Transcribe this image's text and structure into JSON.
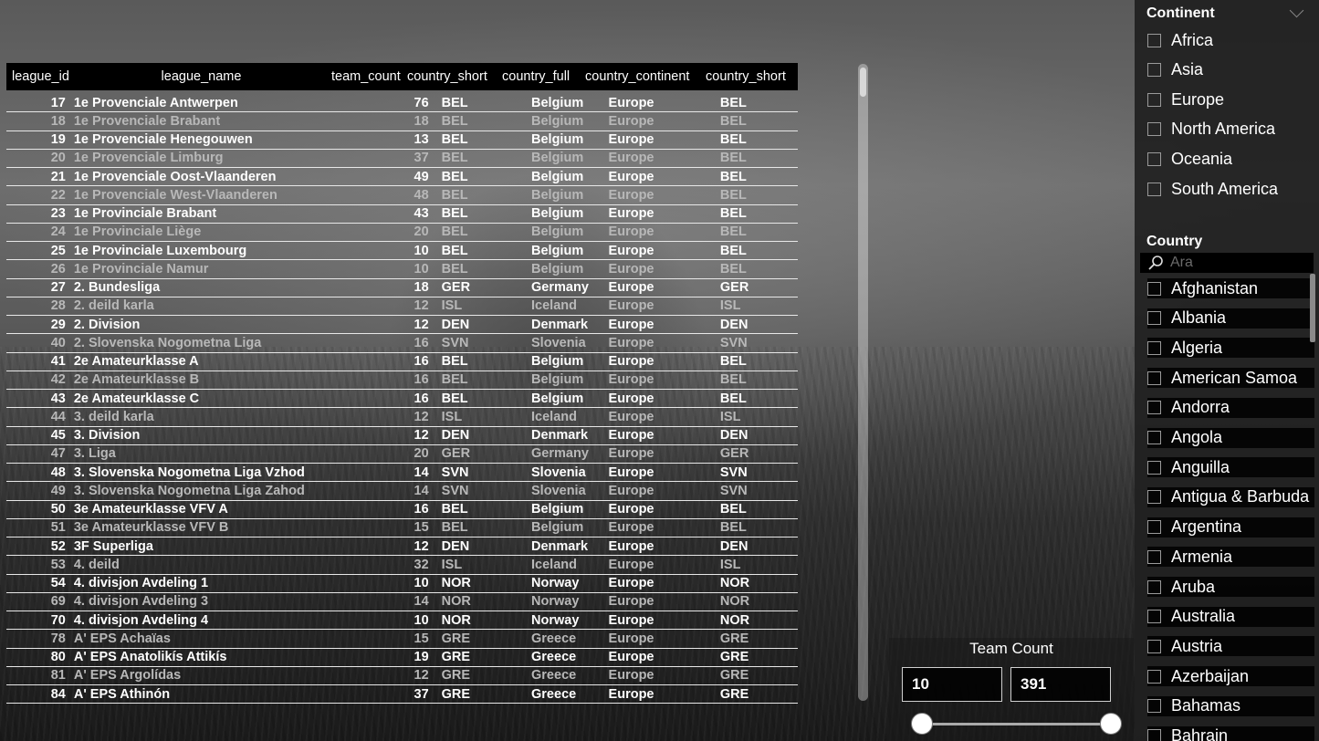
{
  "table": {
    "columns": [
      "league_id",
      "league_name",
      "team_count",
      "country_short",
      "country_full",
      "country_continent",
      "country_short"
    ],
    "rows": [
      {
        "id": "17",
        "name": "1e Provenciale Antwerpen",
        "count": "76",
        "short": "BEL",
        "full": "Belgium",
        "continent": "Europe",
        "short2": "BEL",
        "dim": false
      },
      {
        "id": "18",
        "name": "1e Provenciale Brabant",
        "count": "18",
        "short": "BEL",
        "full": "Belgium",
        "continent": "Europe",
        "short2": "BEL",
        "dim": true
      },
      {
        "id": "19",
        "name": "1e Provenciale Henegouwen",
        "count": "13",
        "short": "BEL",
        "full": "Belgium",
        "continent": "Europe",
        "short2": "BEL",
        "dim": false
      },
      {
        "id": "20",
        "name": "1e Provenciale Limburg",
        "count": "37",
        "short": "BEL",
        "full": "Belgium",
        "continent": "Europe",
        "short2": "BEL",
        "dim": true
      },
      {
        "id": "21",
        "name": "1e Provenciale Oost-Vlaanderen",
        "count": "49",
        "short": "BEL",
        "full": "Belgium",
        "continent": "Europe",
        "short2": "BEL",
        "dim": false
      },
      {
        "id": "22",
        "name": "1e Provenciale West-Vlaanderen",
        "count": "48",
        "short": "BEL",
        "full": "Belgium",
        "continent": "Europe",
        "short2": "BEL",
        "dim": true
      },
      {
        "id": "23",
        "name": "1e Provinciale Brabant",
        "count": "43",
        "short": "BEL",
        "full": "Belgium",
        "continent": "Europe",
        "short2": "BEL",
        "dim": false
      },
      {
        "id": "24",
        "name": "1e Provinciale Liège",
        "count": "20",
        "short": "BEL",
        "full": "Belgium",
        "continent": "Europe",
        "short2": "BEL",
        "dim": true
      },
      {
        "id": "25",
        "name": "1e Provinciale Luxembourg",
        "count": "10",
        "short": "BEL",
        "full": "Belgium",
        "continent": "Europe",
        "short2": "BEL",
        "dim": false
      },
      {
        "id": "26",
        "name": "1e Provinciale Namur",
        "count": "10",
        "short": "BEL",
        "full": "Belgium",
        "continent": "Europe",
        "short2": "BEL",
        "dim": true
      },
      {
        "id": "27",
        "name": "2. Bundesliga",
        "count": "18",
        "short": "GER",
        "full": "Germany",
        "continent": "Europe",
        "short2": "GER",
        "dim": false
      },
      {
        "id": "28",
        "name": "2. deild karla",
        "count": "12",
        "short": "ISL",
        "full": "Iceland",
        "continent": "Europe",
        "short2": "ISL",
        "dim": true
      },
      {
        "id": "29",
        "name": "2. Division",
        "count": "12",
        "short": "DEN",
        "full": "Denmark",
        "continent": "Europe",
        "short2": "DEN",
        "dim": false
      },
      {
        "id": "40",
        "name": "2. Slovenska Nogometna Liga",
        "count": "16",
        "short": "SVN",
        "full": "Slovenia",
        "continent": "Europe",
        "short2": "SVN",
        "dim": true
      },
      {
        "id": "41",
        "name": "2e Amateurklasse A",
        "count": "16",
        "short": "BEL",
        "full": "Belgium",
        "continent": "Europe",
        "short2": "BEL",
        "dim": false
      },
      {
        "id": "42",
        "name": "2e Amateurklasse B",
        "count": "16",
        "short": "BEL",
        "full": "Belgium",
        "continent": "Europe",
        "short2": "BEL",
        "dim": true
      },
      {
        "id": "43",
        "name": "2e Amateurklasse C",
        "count": "16",
        "short": "BEL",
        "full": "Belgium",
        "continent": "Europe",
        "short2": "BEL",
        "dim": false
      },
      {
        "id": "44",
        "name": "3. deild karla",
        "count": "12",
        "short": "ISL",
        "full": "Iceland",
        "continent": "Europe",
        "short2": "ISL",
        "dim": true
      },
      {
        "id": "45",
        "name": "3. Division",
        "count": "12",
        "short": "DEN",
        "full": "Denmark",
        "continent": "Europe",
        "short2": "DEN",
        "dim": false
      },
      {
        "id": "47",
        "name": "3. Liga",
        "count": "20",
        "short": "GER",
        "full": "Germany",
        "continent": "Europe",
        "short2": "GER",
        "dim": true
      },
      {
        "id": "48",
        "name": "3. Slovenska Nogometna Liga Vzhod",
        "count": "14",
        "short": "SVN",
        "full": "Slovenia",
        "continent": "Europe",
        "short2": "SVN",
        "dim": false
      },
      {
        "id": "49",
        "name": "3. Slovenska Nogometna Liga Zahod",
        "count": "14",
        "short": "SVN",
        "full": "Slovenia",
        "continent": "Europe",
        "short2": "SVN",
        "dim": true
      },
      {
        "id": "50",
        "name": "3e Amateurklasse VFV A",
        "count": "16",
        "short": "BEL",
        "full": "Belgium",
        "continent": "Europe",
        "short2": "BEL",
        "dim": false
      },
      {
        "id": "51",
        "name": "3e Amateurklasse VFV B",
        "count": "15",
        "short": "BEL",
        "full": "Belgium",
        "continent": "Europe",
        "short2": "BEL",
        "dim": true
      },
      {
        "id": "52",
        "name": "3F Superliga",
        "count": "12",
        "short": "DEN",
        "full": "Denmark",
        "continent": "Europe",
        "short2": "DEN",
        "dim": false
      },
      {
        "id": "53",
        "name": "4. deild",
        "count": "32",
        "short": "ISL",
        "full": "Iceland",
        "continent": "Europe",
        "short2": "ISL",
        "dim": true
      },
      {
        "id": "54",
        "name": "4. divisjon Avdeling 1",
        "count": "10",
        "short": "NOR",
        "full": "Norway",
        "continent": "Europe",
        "short2": "NOR",
        "dim": false
      },
      {
        "id": "69",
        "name": "4. divisjon Avdeling 3",
        "count": "14",
        "short": "NOR",
        "full": "Norway",
        "continent": "Europe",
        "short2": "NOR",
        "dim": true
      },
      {
        "id": "70",
        "name": "4. divisjon Avdeling 4",
        "count": "10",
        "short": "NOR",
        "full": "Norway",
        "continent": "Europe",
        "short2": "NOR",
        "dim": false
      },
      {
        "id": "78",
        "name": "A' EPS Achaïas",
        "count": "15",
        "short": "GRE",
        "full": "Greece",
        "continent": "Europe",
        "short2": "GRE",
        "dim": true
      },
      {
        "id": "80",
        "name": "A' EPS Anatolikís Attikís",
        "count": "19",
        "short": "GRE",
        "full": "Greece",
        "continent": "Europe",
        "short2": "GRE",
        "dim": false
      },
      {
        "id": "81",
        "name": "A' EPS Argolídas",
        "count": "12",
        "short": "GRE",
        "full": "Greece",
        "continent": "Europe",
        "short2": "GRE",
        "dim": true
      },
      {
        "id": "84",
        "name": "A' EPS Athinón",
        "count": "37",
        "short": "GRE",
        "full": "Greece",
        "continent": "Europe",
        "short2": "GRE",
        "dim": false
      }
    ]
  },
  "continent_slicer": {
    "title": "Continent",
    "options": [
      "Africa",
      "Asia",
      "Europe",
      "North America",
      "Oceania",
      "South America"
    ]
  },
  "country_slicer": {
    "title": "Country",
    "search_placeholder": "Ara",
    "options": [
      "Afghanistan",
      "Albania",
      "Algeria",
      "American Samoa",
      "Andorra",
      "Angola",
      "Anguilla",
      "Antigua & Barbuda",
      "Argentina",
      "Armenia",
      "Aruba",
      "Australia",
      "Austria",
      "Azerbaijan",
      "Bahamas",
      "Bahrain"
    ]
  },
  "team_count": {
    "title": "Team Count",
    "min": "10",
    "max": "391"
  },
  "icons": {
    "search": "search-icon",
    "chevron": "chevron-down-icon"
  }
}
